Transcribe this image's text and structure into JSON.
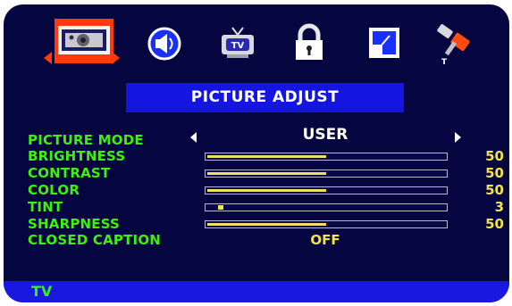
{
  "tabs": [
    {
      "icon": "picture-icon",
      "selected": true
    },
    {
      "icon": "speaker-icon",
      "selected": false
    },
    {
      "icon": "tv-icon",
      "selected": false
    },
    {
      "icon": "lock-icon",
      "selected": false
    },
    {
      "icon": "pip-icon",
      "selected": false
    },
    {
      "icon": "tools-icon",
      "selected": false
    }
  ],
  "tv_icon_text": "TV",
  "menu": {
    "title": "PICTURE ADJUST"
  },
  "picture_mode": {
    "label": "PICTURE MODE",
    "value": "USER"
  },
  "sliders": [
    {
      "label": "BRIGHTNESS",
      "value": "50",
      "level": 0.5
    },
    {
      "label": "CONTRAST",
      "value": "50",
      "level": 0.5
    },
    {
      "label": "COLOR",
      "value": "50",
      "level": 0.5
    },
    {
      "label": "TINT",
      "value": "3",
      "level": 0.03
    },
    {
      "label": "SHARPNESS",
      "value": "50",
      "level": 0.5
    }
  ],
  "closed_caption": {
    "label": "CLOSED CAPTION",
    "value": "OFF"
  },
  "footer": {
    "source": "TV"
  },
  "colors": {
    "background": "#050540",
    "title_bar": "#1515e0",
    "label_green": "#3cf20a",
    "value_yellow": "#f2e34a",
    "bar_fill": "#f0e060",
    "selection_orange": "#ff3a10"
  }
}
